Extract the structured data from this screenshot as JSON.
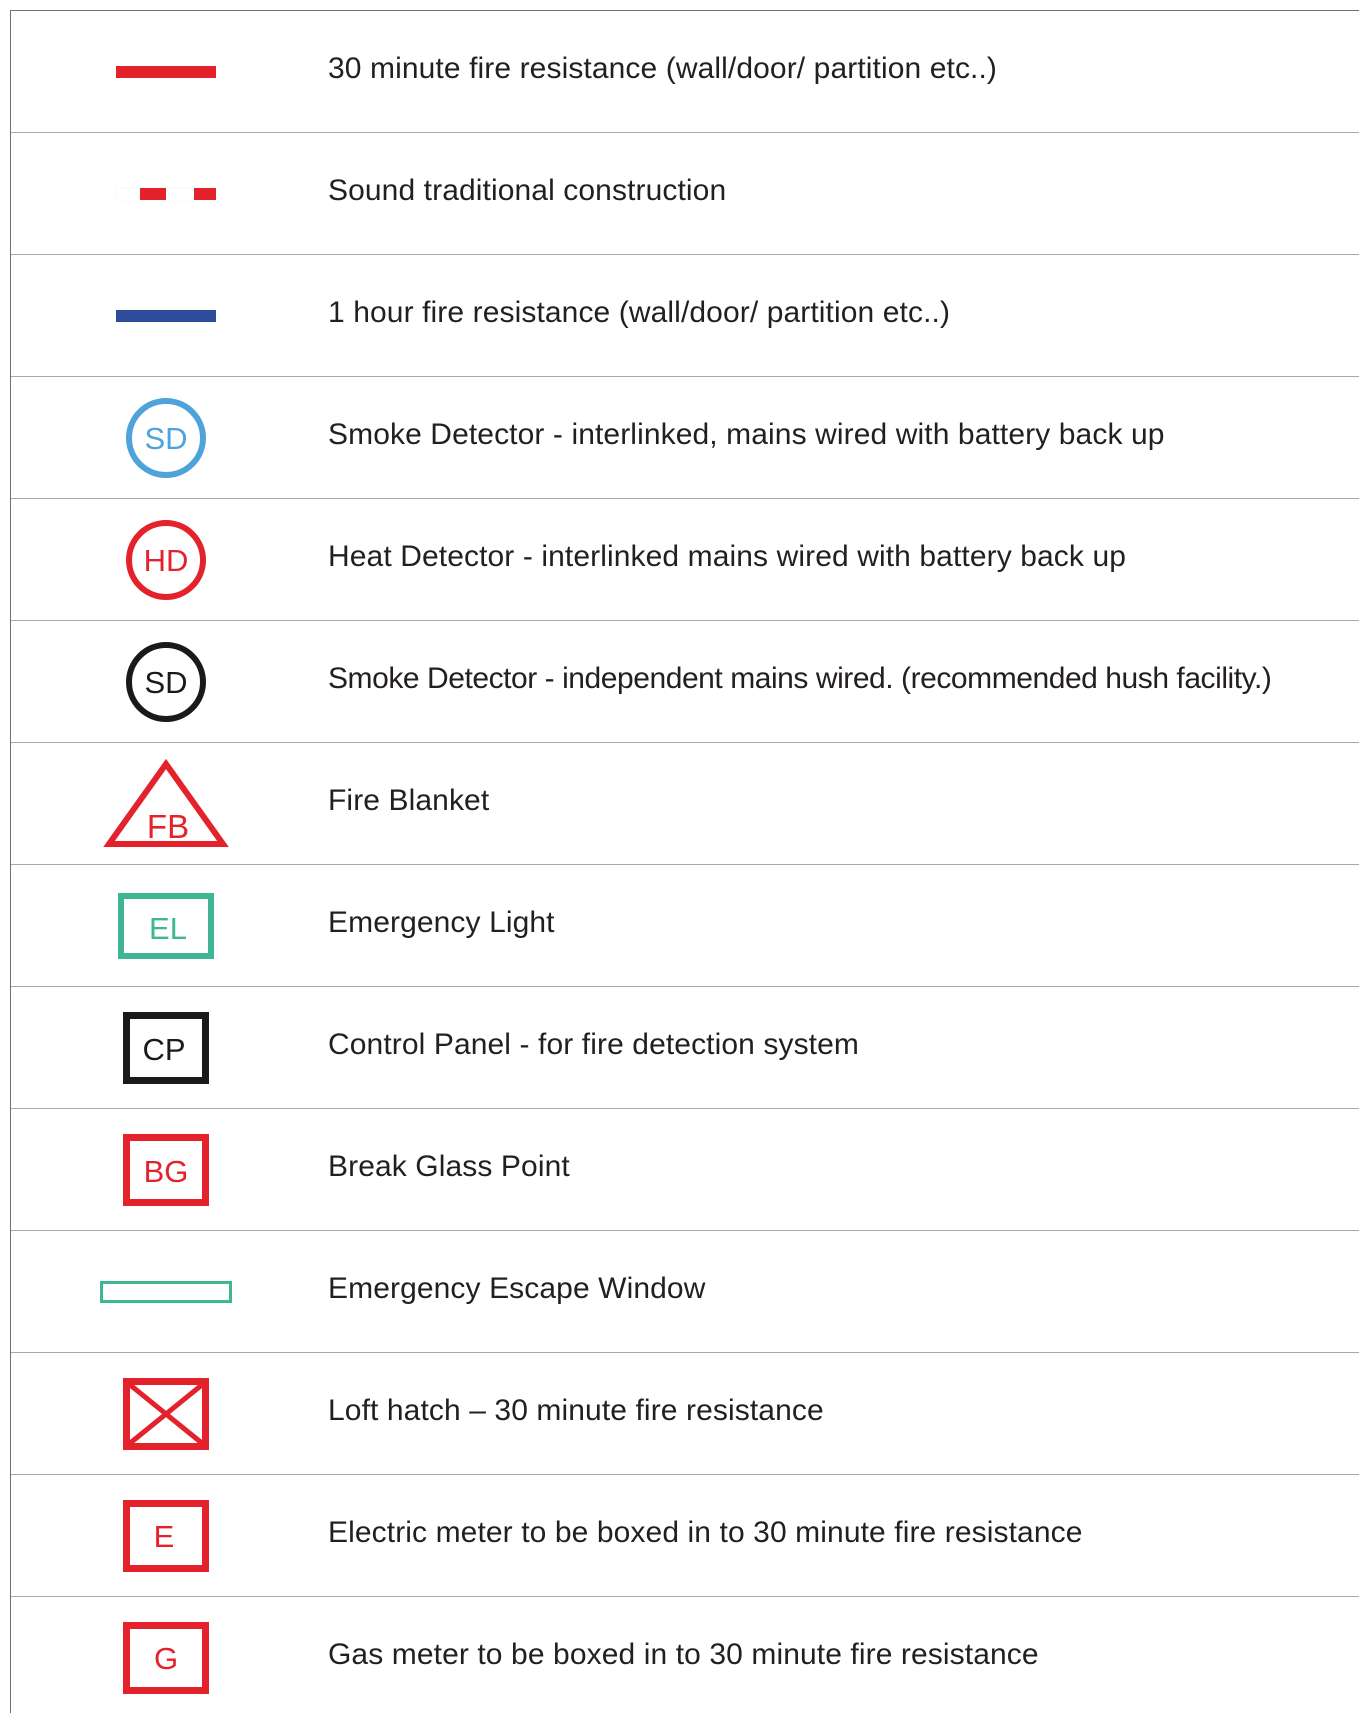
{
  "colors": {
    "red": "#e3222b",
    "blue": "#2e4b9c",
    "light_blue": "#4fa3db",
    "green": "#3fb594",
    "black": "#1a1a1a"
  },
  "legend": [
    {
      "symbol": "red-solid-line-icon",
      "label": "30 minute fire resistance (wall/door/ partition etc..)"
    },
    {
      "symbol": "red-dashed-line-icon",
      "label": "Sound traditional construction"
    },
    {
      "symbol": "blue-solid-line-icon",
      "label": "1 hour fire resistance (wall/door/ partition etc..)"
    },
    {
      "symbol": "blue-circle-icon",
      "code": "SD",
      "label": "Smoke Detector - interlinked, mains wired with battery back up"
    },
    {
      "symbol": "red-circle-icon",
      "code": "HD",
      "label": "Heat Detector - interlinked mains wired with battery back up"
    },
    {
      "symbol": "black-circle-icon",
      "code": "SD",
      "label": "Smoke Detector - independent mains wired. (recommended hush facility.)"
    },
    {
      "symbol": "red-triangle-icon",
      "code": "FB",
      "label": "Fire Blanket"
    },
    {
      "symbol": "green-box-icon",
      "code": "EL",
      "label": "Emergency Light"
    },
    {
      "symbol": "black-box-icon",
      "code": "CP",
      "label": "Control Panel - for fire detection system"
    },
    {
      "symbol": "red-box-icon",
      "code": "BG",
      "label": "Break Glass Point"
    },
    {
      "symbol": "green-outline-bar-icon",
      "label": "Emergency Escape Window"
    },
    {
      "symbol": "red-crossed-box-icon",
      "label": "Loft hatch – 30 minute fire resistance"
    },
    {
      "symbol": "red-box-icon",
      "code": "E",
      "label": "Electric meter to be boxed in to 30 minute fire resistance"
    },
    {
      "symbol": "red-box-icon",
      "code": "G",
      "label": "Gas meter to be boxed in to 30 minute fire resistance"
    }
  ]
}
